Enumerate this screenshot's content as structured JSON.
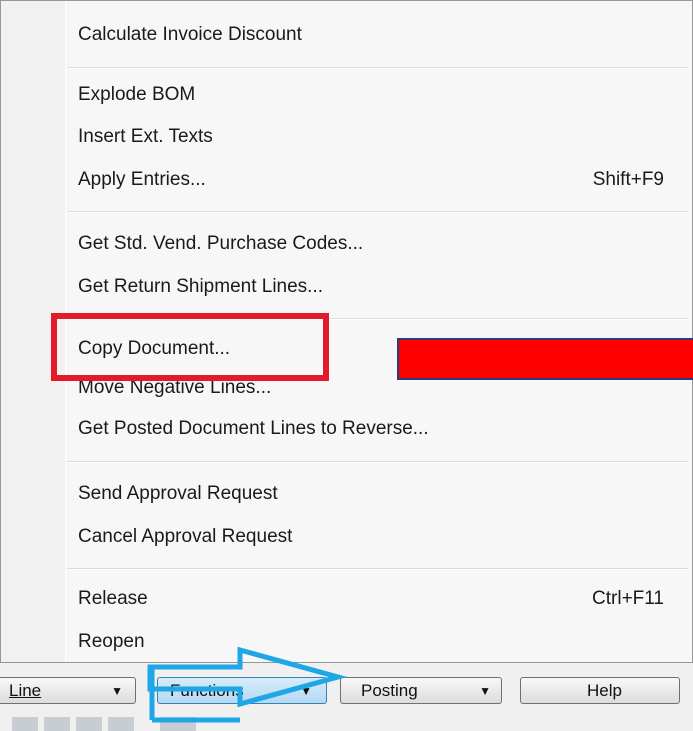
{
  "menu": {
    "items": [
      {
        "label": "Calculate Invoice Discount",
        "shortcut": ""
      },
      {
        "label": "Explode BOM",
        "shortcut": ""
      },
      {
        "label": "Insert Ext. Texts",
        "shortcut": ""
      },
      {
        "label": "Apply Entries...",
        "shortcut": "Shift+F9"
      },
      {
        "label": "Get Std. Vend. Purchase Codes...",
        "shortcut": ""
      },
      {
        "label": "Get Return Shipment Lines...",
        "shortcut": ""
      },
      {
        "label": "Copy Document...",
        "shortcut": ""
      },
      {
        "label": "Move Negative Lines...",
        "shortcut": ""
      },
      {
        "label": "Get Posted Document Lines to Reverse...",
        "shortcut": ""
      },
      {
        "label": "Send Approval Request",
        "shortcut": ""
      },
      {
        "label": "Cancel Approval Request",
        "shortcut": ""
      },
      {
        "label": "Release",
        "shortcut": "Ctrl+F11"
      },
      {
        "label": "Reopen",
        "shortcut": ""
      }
    ]
  },
  "toolbar": {
    "line_label": "Line",
    "functions_label": "Functions",
    "posting_label": "Posting",
    "help_label": "Help"
  },
  "annotations": {
    "highlight_color": "#e21b2b",
    "redaction_color": "#ff0000",
    "arrow_color": "#1ea6e6"
  }
}
